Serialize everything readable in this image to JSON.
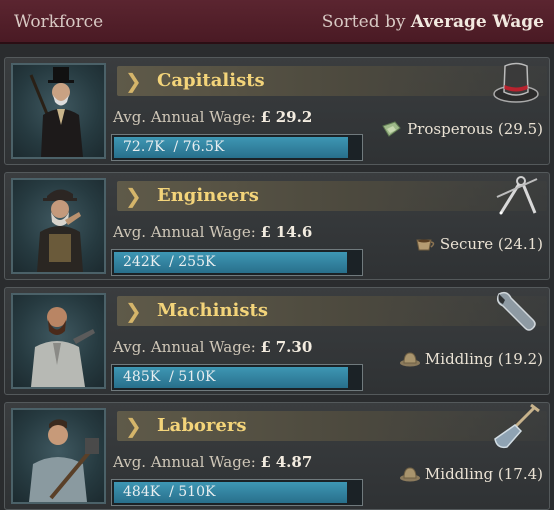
{
  "header": {
    "title": "Workforce",
    "sort_prefix": "Sorted by",
    "sort_key": "Average Wage"
  },
  "pops": [
    {
      "name": "Capitalists",
      "wage_label": "Avg. Annual Wage:",
      "currency": "£",
      "wage": "29.2",
      "employed": "72.7K",
      "capacity": "76.5K",
      "employment_fraction": 0.95,
      "status": "Prosperous (29.5)",
      "status_icon": "prosperous-icon",
      "occupation_icon": "top-hat-icon"
    },
    {
      "name": "Engineers",
      "wage_label": "Avg. Annual Wage:",
      "currency": "£",
      "wage": "14.6",
      "employed": "242K",
      "capacity": "255K",
      "employment_fraction": 0.949,
      "status": "Secure (24.1)",
      "status_icon": "secure-icon",
      "occupation_icon": "compass-icon"
    },
    {
      "name": "Machinists",
      "wage_label": "Avg. Annual Wage:",
      "currency": "£",
      "wage": "7.30",
      "employed": "485K",
      "capacity": "510K",
      "employment_fraction": 0.951,
      "status": "Middling (19.2)",
      "status_icon": "middling-icon",
      "occupation_icon": "wrench-icon"
    },
    {
      "name": "Laborers",
      "wage_label": "Avg. Annual Wage:",
      "currency": "£",
      "wage": "4.87",
      "employed": "484K",
      "capacity": "510K",
      "employment_fraction": 0.949,
      "status": "Middling (17.4)",
      "status_icon": "middling-icon",
      "occupation_icon": "shovel-icon"
    }
  ]
}
